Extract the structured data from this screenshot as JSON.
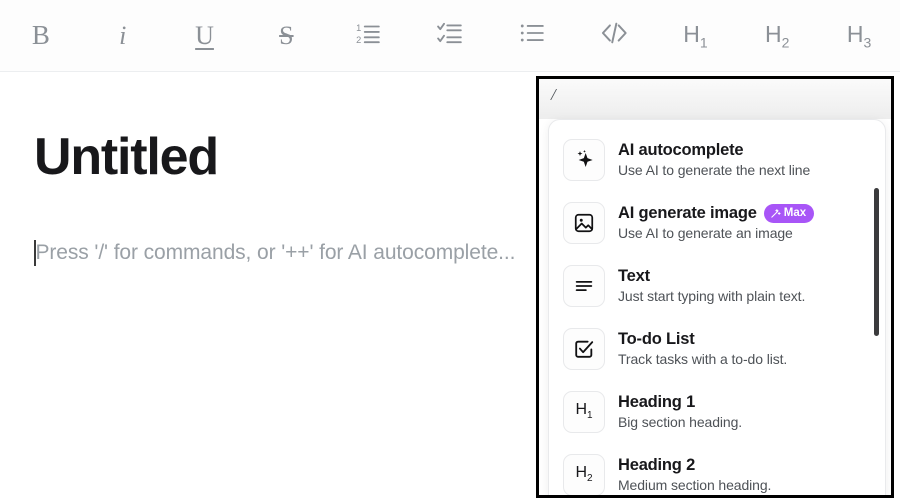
{
  "toolbar": {
    "buttons": [
      {
        "name": "bold",
        "glyph": "B",
        "style": "bold",
        "label": "Bold"
      },
      {
        "name": "italic",
        "glyph": "i",
        "style": "ital",
        "label": "Italic"
      },
      {
        "name": "underline",
        "glyph": "U",
        "style": "under",
        "label": "Underline"
      },
      {
        "name": "strikethrough",
        "glyph": "S",
        "style": "strike",
        "label": "Strikethrough"
      },
      {
        "name": "ordered-list",
        "glyph": "",
        "style": "svg",
        "label": "Numbered list"
      },
      {
        "name": "check-list",
        "glyph": "",
        "style": "svg",
        "label": "Check list"
      },
      {
        "name": "bullet-list",
        "glyph": "",
        "style": "svg",
        "label": "Bulleted list"
      },
      {
        "name": "code-block",
        "glyph": "",
        "style": "svg",
        "label": "Code"
      },
      {
        "name": "heading-1",
        "glyph": "H",
        "style": "head",
        "label": "H1",
        "sub": "1"
      },
      {
        "name": "heading-2",
        "glyph": "H",
        "style": "head",
        "label": "H2",
        "sub": "2"
      },
      {
        "name": "heading-3",
        "glyph": "H",
        "style": "head",
        "label": "H3",
        "sub": "3"
      }
    ]
  },
  "editor": {
    "title": "Untitled",
    "placeholder": "Press '/' for commands, or '++' for AI autocomplete..."
  },
  "slash_popup": {
    "query": "/",
    "items": [
      {
        "icon": "sparkle-icon",
        "title": "AI autocomplete",
        "description": "Use AI to generate the next line",
        "badge": null
      },
      {
        "icon": "image-icon",
        "title": "AI generate image",
        "description": "Use AI to generate an image",
        "badge": {
          "label": "Max",
          "icon": "wand-icon",
          "color": "#a855f7"
        }
      },
      {
        "icon": "text-lines-icon",
        "title": "Text",
        "description": "Just start typing with plain text.",
        "badge": null
      },
      {
        "icon": "checkbox-icon",
        "title": "To-do List",
        "description": "Track tasks with a to-do list.",
        "badge": null
      },
      {
        "icon": "h1-icon",
        "title": "Heading 1",
        "description": "Big section heading.",
        "badge": null,
        "icon_text": "H",
        "icon_sub": "1"
      },
      {
        "icon": "h2-icon",
        "title": "Heading 2",
        "description": "Medium section heading.",
        "badge": null,
        "icon_text": "H",
        "icon_sub": "2"
      }
    ]
  },
  "colors": {
    "accent_purple": "#a855f7",
    "toolbar_icon": "#8b9096",
    "title_text": "#18181b",
    "placeholder_text": "#9aa0a6",
    "popup_border": "#000000"
  }
}
